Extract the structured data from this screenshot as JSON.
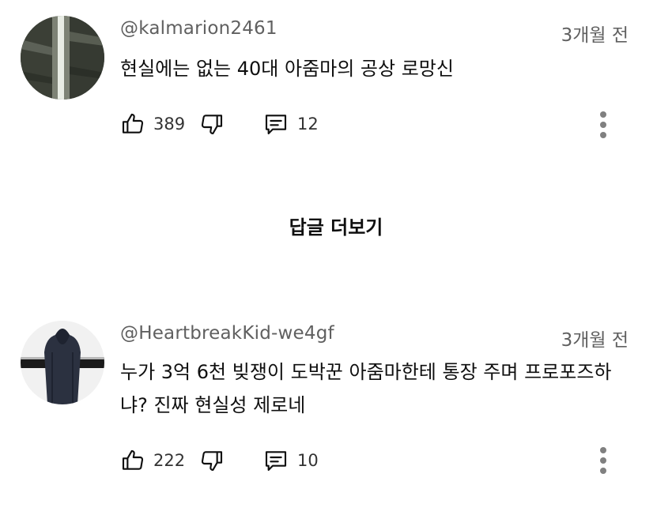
{
  "comments": [
    {
      "author": "@kalmarion2461",
      "time": "3개월 전",
      "text": "현실에는 없는 40대 아줌마의 공상 로망신",
      "likes": "389",
      "replies": "12"
    },
    {
      "author": "@HeartbreakKid-we4gf",
      "time": "3개월 전",
      "text": "누가 3억 6천 빚쟁이 도박꾼 아줌마한테 통장 주며 프로포즈하냐? 진짜 현실성 제로네",
      "likes": "222",
      "replies": "10"
    }
  ],
  "more_replies_label": "답글 더보기",
  "icons": [
    "thumbs-up-icon",
    "thumbs-down-icon",
    "reply-comment-icon",
    "more-vert-icon"
  ]
}
